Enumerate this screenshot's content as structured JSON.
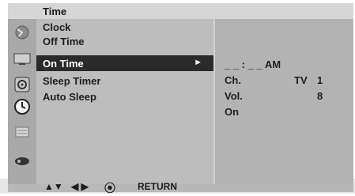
{
  "header": {
    "title": "Time"
  },
  "icons": [
    "picture-icon",
    "screen-icon",
    "audio-icon",
    "time-icon",
    "option-icon",
    "lock-icon"
  ],
  "menu": {
    "items": [
      {
        "label": "Clock",
        "active": false
      },
      {
        "label": "Off Time",
        "active": false
      },
      {
        "label": "On Time",
        "active": true
      },
      {
        "label": "Sleep Timer",
        "active": false
      },
      {
        "label": "Auto Sleep",
        "active": false
      }
    ],
    "arrow": "►"
  },
  "detail": {
    "time": "_ _ : _ _ AM",
    "channel_label": "Ch.",
    "channel_source": "TV",
    "channel_number": "1",
    "volume_label": "Vol.",
    "volume_value": "8",
    "state": "On"
  },
  "help": {
    "up_down": "▲▼",
    "left_right": "◀ ▶",
    "ok_icon": "⦿",
    "return_label": "RETURN"
  }
}
